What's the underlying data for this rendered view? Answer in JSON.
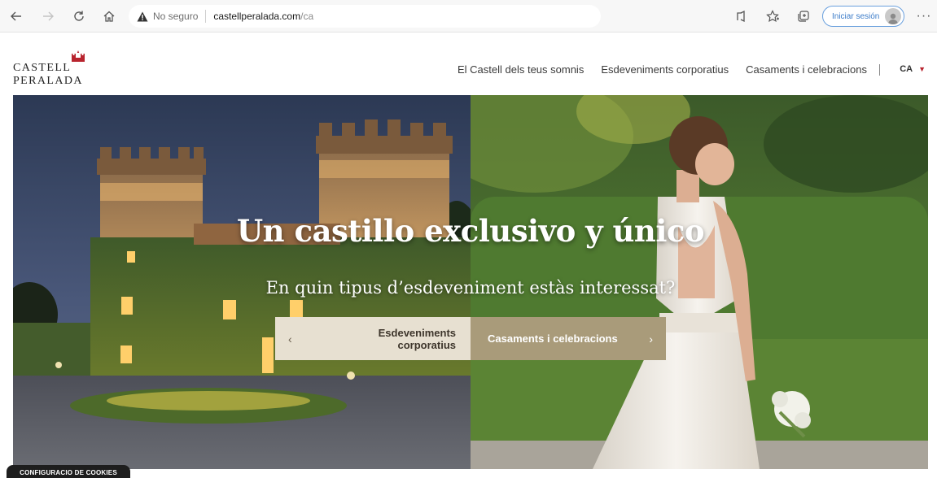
{
  "browser": {
    "security_label": "No seguro",
    "url_host": "castellperalada.com",
    "url_path": "/ca",
    "signin_label": "Iniciar sesión",
    "icons": {
      "back": "arrow-left-icon",
      "forward": "arrow-right-icon",
      "refresh": "refresh-icon",
      "home": "home-icon",
      "warning": "warning-triangle-icon",
      "read_aloud": "read-aloud-icon",
      "favorites": "favorites-icon",
      "collections": "collections-icon",
      "more": "more-icon"
    }
  },
  "site": {
    "logo_text": "CASTELL PERALADA",
    "nav": [
      {
        "label": "El Castell dels teus somnis"
      },
      {
        "label": "Esdeveniments corporatius"
      },
      {
        "label": "Casaments i celebracions"
      }
    ],
    "language": "CA"
  },
  "hero": {
    "title": "Un castillo exclusivo y único",
    "subtitle": "En quin tipus d’esdeveniment estàs interessat?",
    "left_option": "Esdeveniments corporatius",
    "right_option": "Casaments i celebracions"
  },
  "cookie_banner": {
    "label": "CONFIGURACIO DE COOKIES"
  },
  "colors": {
    "brand_red": "#b8242e",
    "option_light": "#e7e0d1",
    "option_dark": "#a99b7a",
    "signin_blue": "#3c7cc9"
  }
}
